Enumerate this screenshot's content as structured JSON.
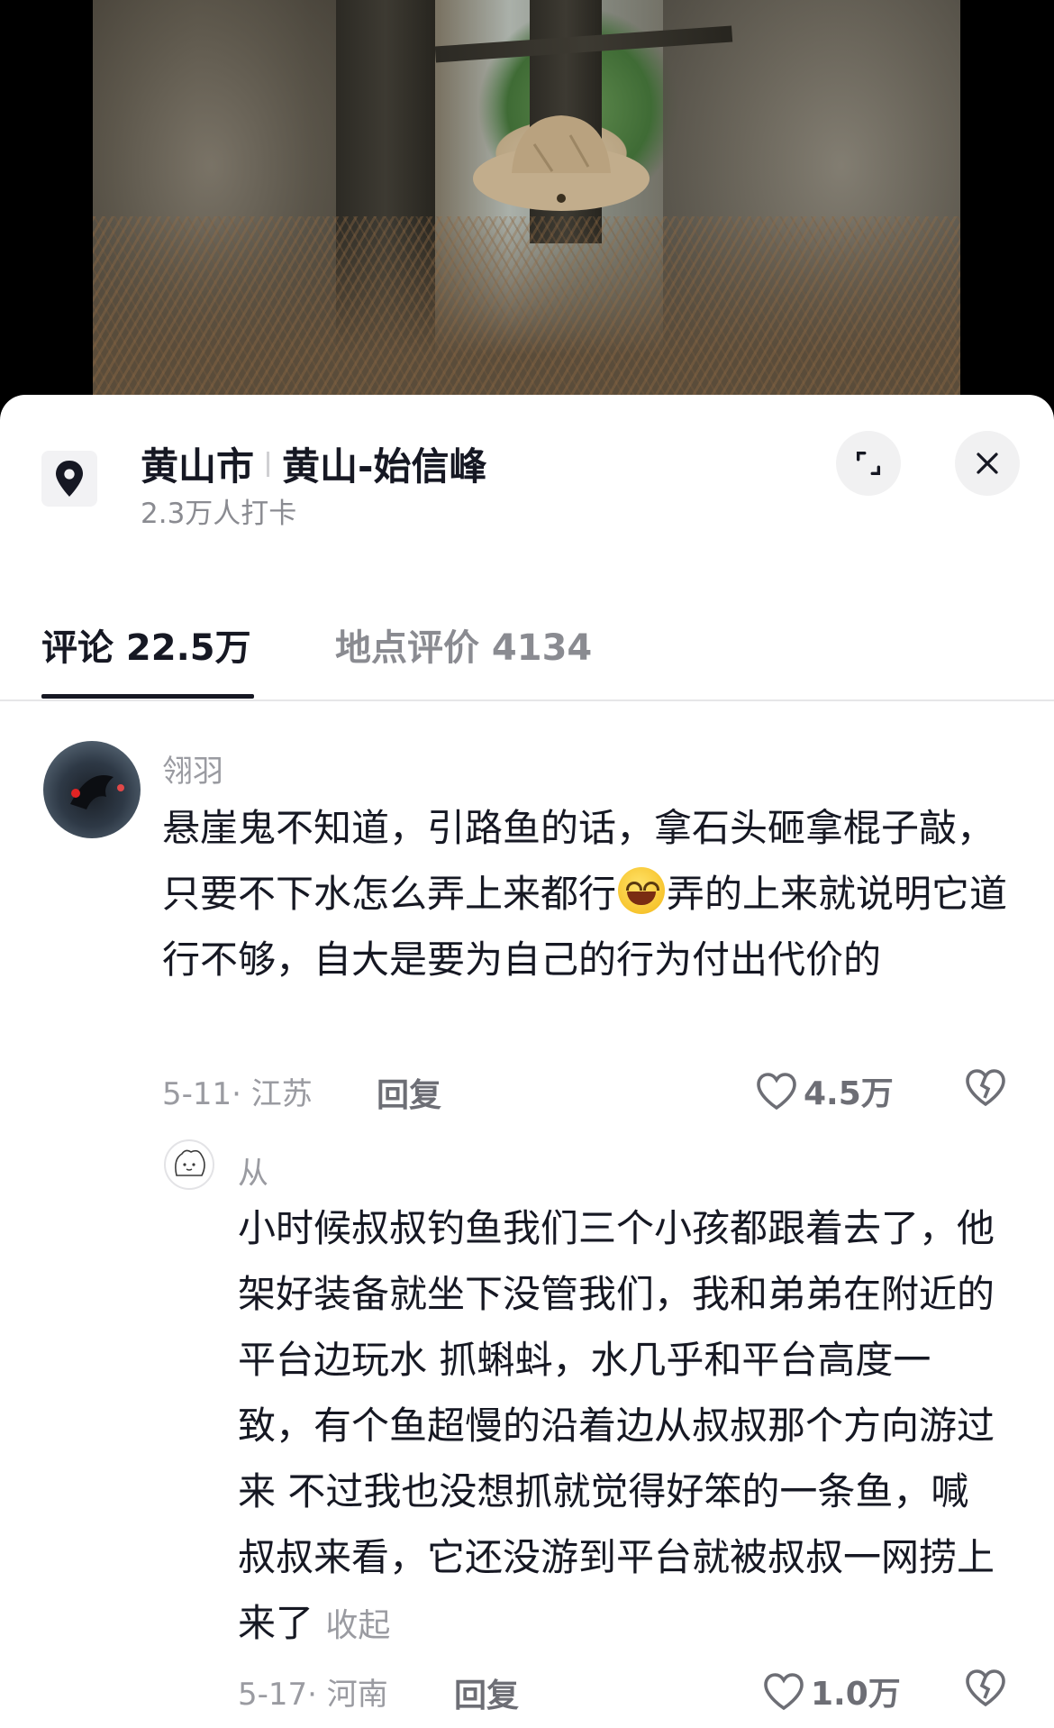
{
  "location": {
    "city": "黄山市",
    "spot": "黄山-始信峰",
    "checkins": "2.3万人打卡"
  },
  "tabs": [
    {
      "label": "评论 22.5万",
      "active": true
    },
    {
      "label": "地点评价 4134",
      "active": false
    }
  ],
  "comments": [
    {
      "user": "翎羽",
      "text_before_emoji": "悬崖鬼不知道，引路鱼的话，拿石头砸拿棍子敲，只要不下水怎么弄上来都行",
      "emoji": "grinning-emoji",
      "text_after_emoji": "弄的上来就说明它道行不够，自大是要为自己的行为付出代价的",
      "meta": "5-11· 江苏",
      "reply_label": "回复",
      "likes": "4.5万"
    }
  ],
  "reply": {
    "user": "从",
    "text": "小时候叔叔钓鱼我们三个小孩都跟着去了，他架好装备就坐下没管我们，我和弟弟在附近的平台边玩水 抓蝌蚪，水几乎和平台高度一致，有个鱼超慢的沿着边从叔叔那个方向游过来 不过我也没想抓就觉得好笨的一条鱼，喊叔叔来看，它还没游到平台就被叔叔一网捞上来了",
    "collapse_label": "收起",
    "meta": "5-17· 河南",
    "reply_label": "回复",
    "likes": "1.0万"
  }
}
